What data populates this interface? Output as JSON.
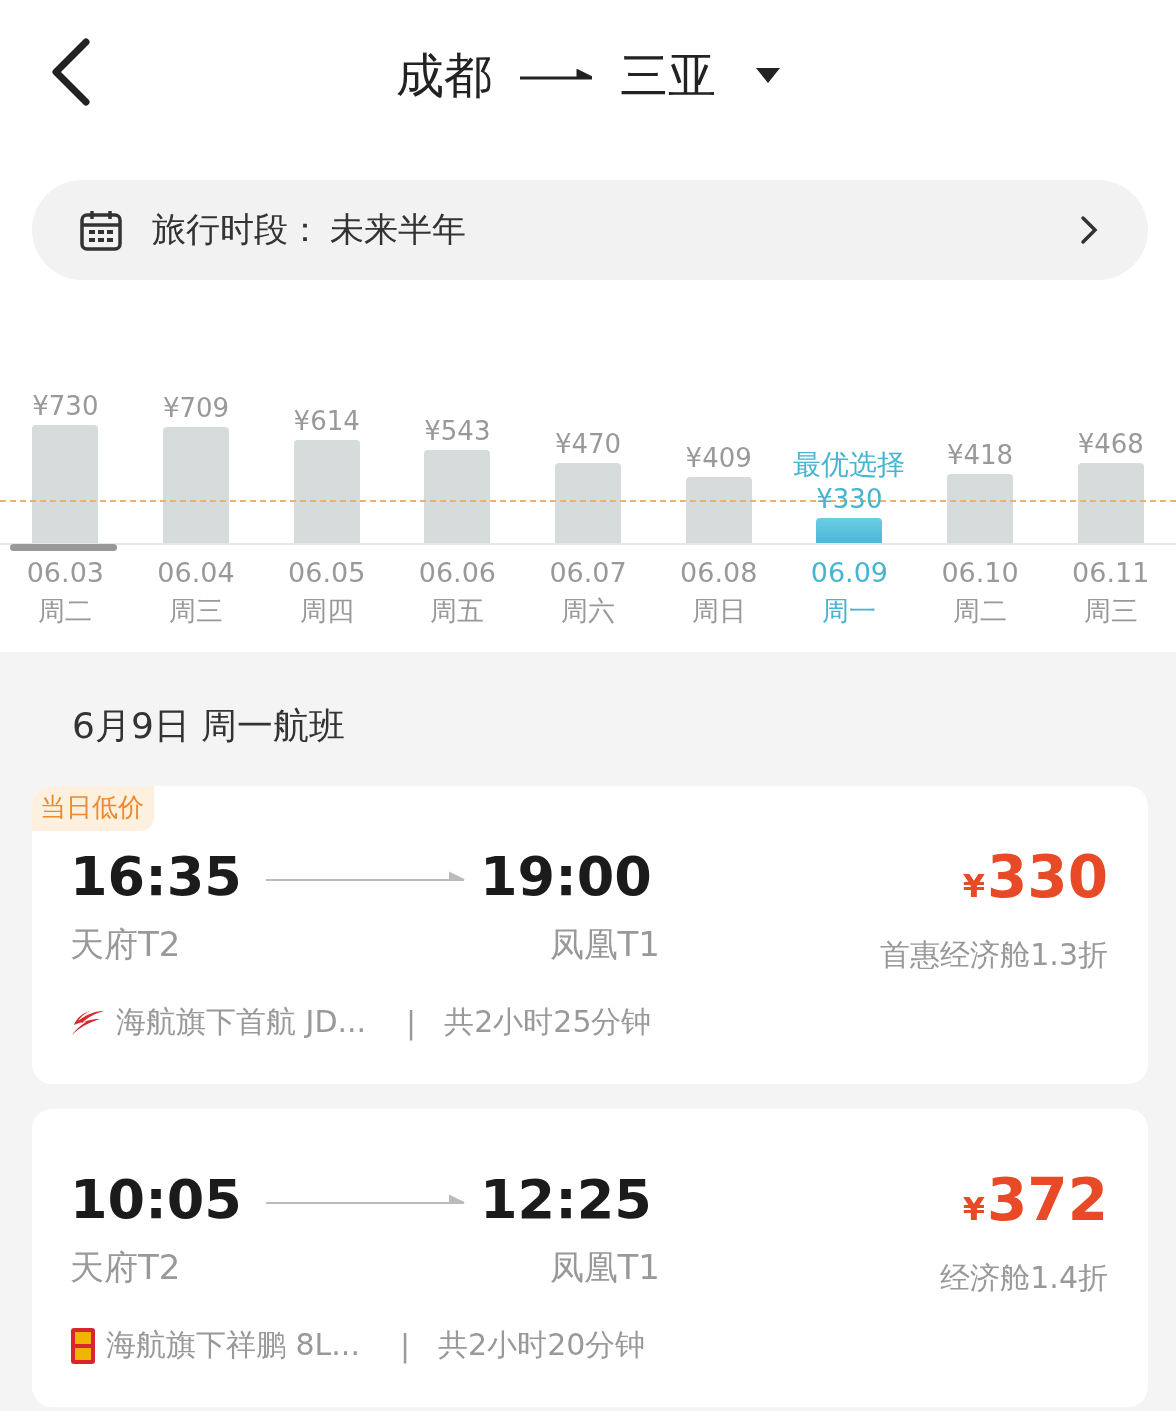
{
  "header": {
    "origin": "成都",
    "destination": "三亚"
  },
  "period": {
    "label": "旅行时段：",
    "value": "未来半年"
  },
  "days": [
    {
      "price": "¥730",
      "date": "06.03",
      "weekday": "周二",
      "selected": false
    },
    {
      "price": "¥709",
      "date": "06.04",
      "weekday": "周三",
      "selected": false
    },
    {
      "price": "¥614",
      "date": "06.05",
      "weekday": "周四",
      "selected": false
    },
    {
      "price": "¥543",
      "date": "06.06",
      "weekday": "周五",
      "selected": false
    },
    {
      "price": "¥470",
      "date": "06.07",
      "weekday": "周六",
      "selected": false
    },
    {
      "price": "¥409",
      "date": "06.08",
      "weekday": "周日",
      "selected": false
    },
    {
      "badge": "最优选择",
      "price": "¥330",
      "date": "06.09",
      "weekday": "周一",
      "selected": true
    },
    {
      "price": "¥418",
      "date": "06.10",
      "weekday": "周二",
      "selected": false
    },
    {
      "price": "¥468",
      "date": "06.11",
      "weekday": "周三",
      "selected": false
    }
  ],
  "section_title": "6月9日 周一航班",
  "flights": [
    {
      "badge": "当日低价",
      "dep_time": "16:35",
      "arr_time": "19:00",
      "dep_terminal": "天府T2",
      "arr_terminal": "凤凰T1",
      "currency": "¥",
      "price": "330",
      "cabin": "首惠经济舱1.3折",
      "kind": "swoosh",
      "airline": "海航旗下首航 JD...",
      "separator": "|",
      "duration": "共2小时25分钟"
    },
    {
      "dep_time": "10:05",
      "arr_time": "12:25",
      "dep_terminal": "天府T2",
      "arr_terminal": "凤凰T1",
      "currency": "¥",
      "price": "372",
      "cabin": "经济舱1.4折",
      "kind": "seal",
      "airline": "海航旗下祥鹏 8L...",
      "separator": "|",
      "duration": "共2小时20分钟"
    }
  ]
}
